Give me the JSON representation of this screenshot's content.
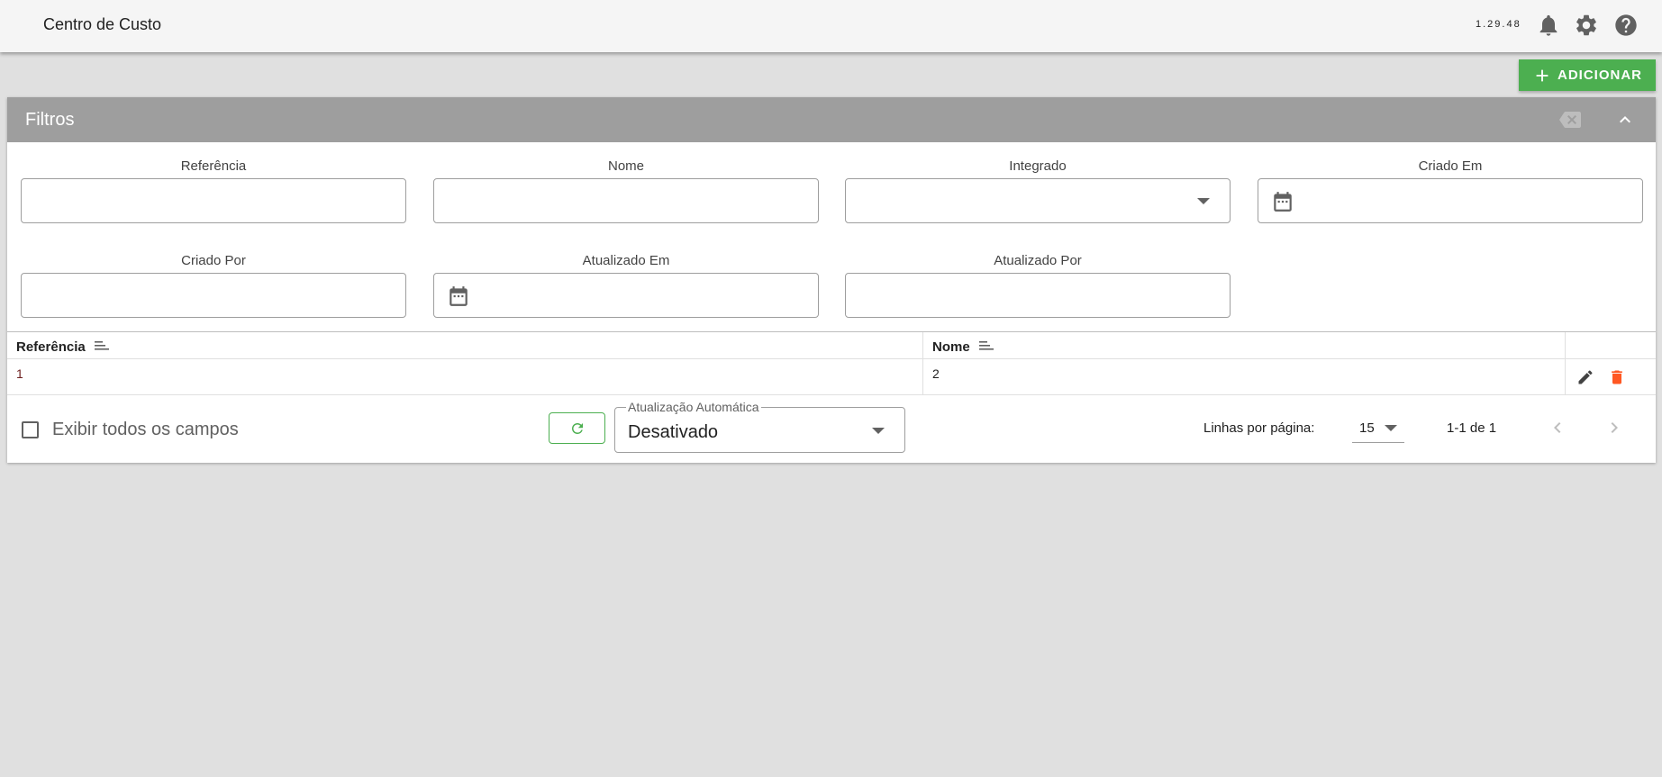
{
  "header": {
    "title": "Centro de Custo",
    "version": "1.29.48",
    "icons": [
      "bell-icon",
      "gear-icon",
      "help-icon"
    ]
  },
  "toolbar": {
    "add_label": "ADICIONAR"
  },
  "filters": {
    "title": "Filtros",
    "fields": {
      "referencia": {
        "label": "Referência",
        "value": ""
      },
      "nome": {
        "label": "Nome",
        "value": ""
      },
      "integrado": {
        "label": "Integrado",
        "value": ""
      },
      "criado_em": {
        "label": "Criado Em",
        "value": ""
      },
      "criado_por": {
        "label": "Criado Por",
        "value": ""
      },
      "atualizado_em": {
        "label": "Atualizado Em",
        "value": ""
      },
      "atualizado_por": {
        "label": "Atualizado Por",
        "value": ""
      }
    }
  },
  "table": {
    "columns": [
      "Referência",
      "Nome"
    ],
    "rows": [
      {
        "referencia": "1",
        "nome": "2"
      }
    ]
  },
  "footer": {
    "show_all_label": "Exibir todos os campos",
    "show_all_checked": false,
    "auto_refresh_label": "Atualização Automática",
    "auto_refresh_value": "Desativado",
    "rows_per_page_label": "Linhas por página:",
    "rows_per_page_value": "15",
    "page_info": "1-1 de 1"
  },
  "colors": {
    "accent": "#4caf50",
    "filter_header": "#9e9e9e",
    "delete": "#ff5722"
  }
}
